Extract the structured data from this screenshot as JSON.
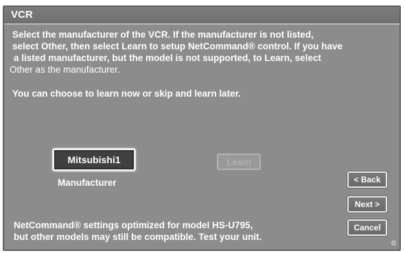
{
  "window": {
    "title": "VCR"
  },
  "instructions": {
    "line1": "Select the manufacturer of the VCR.   If the manufacturer is not listed,",
    "line2": "select Other, then select Learn to setup NetCommand® control. If you have",
    "line3": "a listed manufacturer, but the model is not supported, to Learn, select",
    "line4": "Other as the manufacturer.",
    "line5": "You can choose to learn now or skip and learn later."
  },
  "manufacturer": {
    "value": "Mitsubishi1",
    "label": "Manufacturer"
  },
  "learn_button": {
    "label": "Learn",
    "enabled": false
  },
  "footer": {
    "line1": "NetCommand® settings optimized for model HS-U795,",
    "line2": "but other models may still be compatible. Test your unit."
  },
  "buttons": {
    "back": "< Back",
    "next": "Next >",
    "cancel": "Cancel"
  },
  "copyright": "©"
}
